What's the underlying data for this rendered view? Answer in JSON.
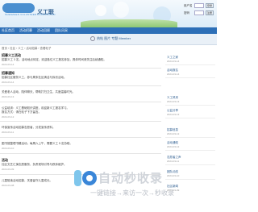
{
  "header": {
    "logo_small": "SHENZHEN VOLUNTEER ASSOCIATION",
    "site_title": "义工联",
    "login": {
      "user_label": "用户名",
      "pass_label": "密码",
      "login_button": "登录",
      "register_button": "注册"
    }
  },
  "nav": {
    "items": [
      "社区首页",
      "活动招募",
      "活动回顾",
      "团队风采"
    ]
  },
  "subbar": {
    "tags": [
      "热帖",
      "图片",
      "专题",
      "Member"
    ]
  },
  "breadcrumb": "首页 › 社区 › 义工 › 活动招募 › 查看帖子",
  "posts": [
    {
      "title": "招募义工活动",
      "lines": [
        "招募义工 3 名，活动地点待定，欢迎各位义工报名参加，具体时间请关注后续通知。"
      ],
      "meta": "2024-03-14"
    },
    {
      "title": "招募通知",
      "lines": [
        "招募社区服务义工，参与周末社区清洁与探访活动。"
      ],
      "meta": "2024-03-14"
    },
    {
      "title": "",
      "lines": [
        "关爱老人活动，陪伴聊天，帮助打扫卫生，共度温馨时光。"
      ],
      "meta": "2024-03-13"
    },
    {
      "title": "",
      "lines": [
        "公益培训：义工基础知识讲座，欢迎新义工报名学习。",
        "报名方式：请在帖子下方留言。"
      ],
      "meta": "2024-03-12"
    },
    {
      "title": "",
      "lines": [
        "环保宣传活动招募志愿者，分发宣传资料。"
      ],
      "meta": "2024-03-11"
    },
    {
      "title": "",
      "lines": [
        "图书馆整理书籍活动，每周六上午，需要义工 5 名协助。"
      ],
      "meta": "2024-03-10"
    },
    {
      "title": "活动",
      "lines": [
        "社区文艺汇演志愿服务，负责现场引导与秩序维护。"
      ],
      "meta": "2024-03-09"
    },
    {
      "title": "",
      "lines": [
        "儿童陪读活动招募，关爱留守儿童成长。"
      ],
      "meta": "2024-03-08"
    }
  ],
  "sidebar": {
    "items": [
      {
        "title": "义工之家",
        "date": "2024-03-14"
      },
      {
        "title": "活动报名",
        "date": "2024-03-14"
      },
      {
        "title": "义工风采",
        "date": "2024-03-13"
      },
      {
        "title": "公益分享",
        "date": "2024-03-13"
      },
      {
        "title": "招募信息",
        "date": "2024-03-12"
      },
      {
        "title": "活动通知",
        "date": "2024-03-12"
      },
      {
        "title": "志愿者之声",
        "date": "2024-03-11"
      },
      {
        "title": "团队动态",
        "date": "2024-03-10"
      },
      {
        "title": "社区新闻",
        "date": "2024-03-09"
      }
    ]
  },
  "watermark": {
    "brand": "自动秒收录",
    "tagline": "一键链接→来访一次→秒收录"
  },
  "colors": {
    "nav_bg": "#2d6fb7",
    "link": "#2c5c8f"
  }
}
